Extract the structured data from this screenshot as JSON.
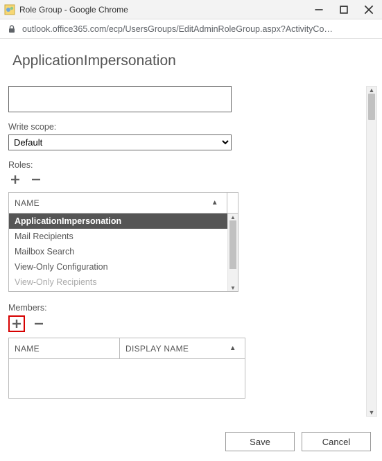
{
  "window": {
    "title": "Role Group - Google Chrome"
  },
  "address": {
    "url": "outlook.office365.com/ecp/UsersGroups/EditAdminRoleGroup.aspx?ActivityCo…"
  },
  "page": {
    "title": "ApplicationImpersonation"
  },
  "writeScope": {
    "label": "Write scope:",
    "value": "Default"
  },
  "roles": {
    "label": "Roles:",
    "header": "NAME",
    "items": [
      {
        "label": "ApplicationImpersonation",
        "selected": true
      },
      {
        "label": "Mail Recipients",
        "selected": false
      },
      {
        "label": "Mailbox Search",
        "selected": false
      },
      {
        "label": "View-Only Configuration",
        "selected": false
      },
      {
        "label": "View-Only Recipients",
        "selected": false,
        "cut": true
      }
    ]
  },
  "members": {
    "label": "Members:",
    "header_name": "NAME",
    "header_display": "DISPLAY NAME"
  },
  "footer": {
    "save": "Save",
    "cancel": "Cancel"
  }
}
